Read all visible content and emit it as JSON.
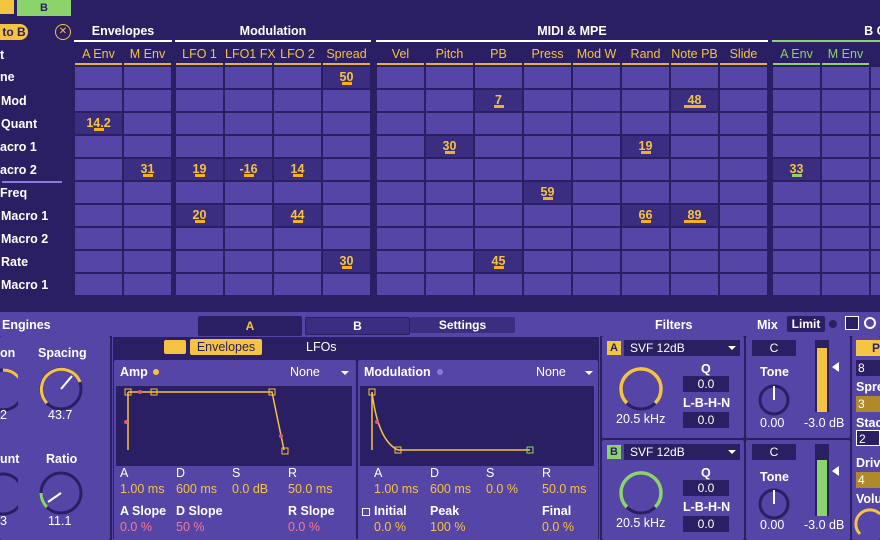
{
  "top": {
    "btn_a": "",
    "btn_b": "B",
    "route_label": "to B",
    "close_glyph": "✕"
  },
  "groups": {
    "envelopes": "Envelopes",
    "modulation": "Modulation",
    "midi_mpe": "MIDI & MPE",
    "b_cross": "B Cross"
  },
  "columns": [
    "A Env",
    "M Env",
    "LFO 1",
    "LFO1 FX",
    "LFO 2",
    "Spread",
    "Vel",
    "Pitch",
    "PB",
    "Press",
    "Mod W",
    "Rand",
    "Note PB",
    "Slide",
    "A Env",
    "M Env"
  ],
  "rows": [
    "t",
    "ne",
    "Mod",
    "Quant",
    "acro 1",
    "acro 2",
    "Freq",
    "Macro 1",
    "Macro 2",
    "Rate",
    "Macro 1"
  ],
  "matrix_values": {
    "r0c5": "50",
    "r1c8": "7",
    "r1c12": "48",
    "r2c0": "14.2",
    "r3c7": "30",
    "r3c11": "19",
    "r4c1": "31",
    "r4c2": "19",
    "r4c3": "-16",
    "r4c4": "14",
    "r4c14": "33",
    "r5c9": "59",
    "r6c2": "20",
    "r6c4": "44",
    "r6c11": "66",
    "r6c12": "89",
    "r8c5": "30",
    "r8c8": "45"
  },
  "bottom": {
    "engines_label": "Engines",
    "tab_a": "A",
    "tab_b": "B",
    "tab_settings": "Settings",
    "filters_label": "Filters",
    "mix_label": "Mix",
    "limit_label": "Limit",
    "left": {
      "on_label": "on",
      "spacing_label": "Spacing",
      "spacing_value": "43.7",
      "left_val1": "2",
      "unt_label": "unt",
      "ratio_label": "Ratio",
      "ratio_value": "11.1",
      "left_val2": "3"
    },
    "env_tab": "Envelopes",
    "lfos_tab": "LFOs",
    "amp": {
      "title": "Amp",
      "target": "None",
      "a_label": "A",
      "d_label": "D",
      "s_label": "S",
      "r_label": "R",
      "a": "1.00 ms",
      "d": "600 ms",
      "s": "0.0 dB",
      "r": "50.0 ms",
      "a_slope_label": "A Slope",
      "d_slope_label": "D Slope",
      "r_slope_label": "R Slope",
      "a_slope": "0.0 %",
      "d_slope": "50 %",
      "r_slope": "0.0 %"
    },
    "modenv": {
      "title": "Modulation",
      "target": "None",
      "a_label": "A",
      "d_label": "D",
      "s_label": "S",
      "r_label": "R",
      "a": "1.00 ms",
      "d": "600 ms",
      "s": "0.0 %",
      "r": "50.0 ms",
      "initial_label": "Initial",
      "peak_label": "Peak",
      "final_label": "Final",
      "initial": "0.0 %",
      "peak": "100 %",
      "final": "0.0 %"
    },
    "filter_a": {
      "badge": "A",
      "type": "SVF 12dB",
      "q_label": "Q",
      "q": "0.0",
      "lbhn_label": "L-B-H-N",
      "lbhn": "0.0",
      "freq": "20.5 kHz"
    },
    "filter_b": {
      "badge": "B",
      "type": "SVF 12dB",
      "q_label": "Q",
      "q": "0.0",
      "lbhn_label": "L-B-H-N",
      "lbhn": "0.0",
      "freq": "20.5 kHz"
    },
    "mix_a": {
      "pan": "C",
      "tone_label": "Tone",
      "tone": "0.00",
      "level": "-3.0 dB"
    },
    "mix_b": {
      "pan": "C",
      "tone_label": "Tone",
      "tone": "0.00",
      "level": "-3.0 dB"
    },
    "right": {
      "p_label": "P",
      "val_8": "8",
      "spre_label": "Spre",
      "val_3": "3",
      "stac_label": "Stac",
      "val_2": "2",
      "driv_label": "Driv",
      "val_4": "4",
      "volu_label": "Volu"
    }
  },
  "colors": {
    "bg": "#2a1f63",
    "cell": "#5545a6",
    "accent": "#f5c342",
    "green": "#8bd36b",
    "panel_light": "#5545a6"
  }
}
